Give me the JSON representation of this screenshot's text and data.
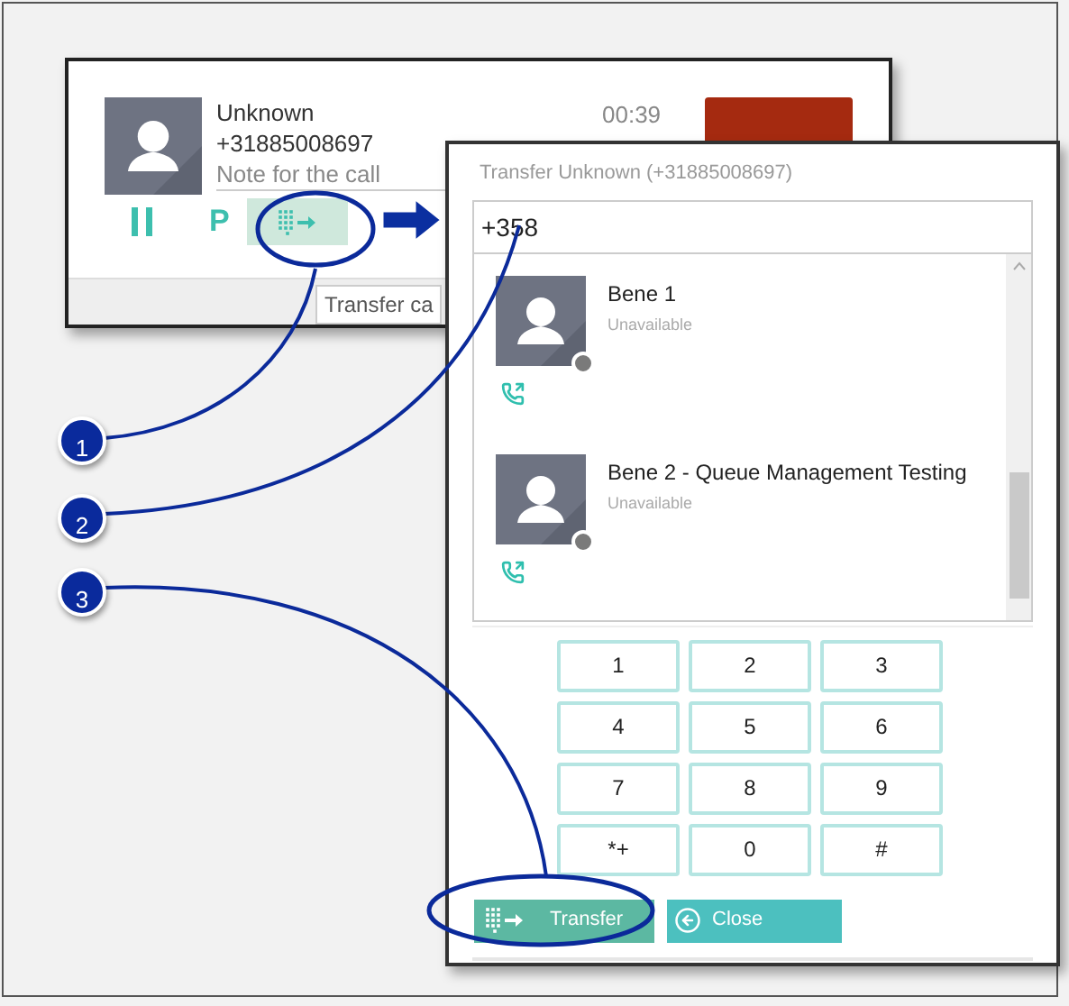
{
  "call_card": {
    "caller_name": "Unknown",
    "caller_number": "+31885008697",
    "note": "Note for the call",
    "timer": "00:39",
    "park_label": "P",
    "tooltip": "Transfer ca"
  },
  "transfer_dialog": {
    "title": "Transfer Unknown (+31885008697)",
    "search": {
      "value": "+358"
    },
    "contacts": [
      {
        "name": "Bene 1",
        "status": "Unavailable"
      },
      {
        "name": "Bene 2 - Queue Management Testing",
        "status": "Unavailable"
      }
    ],
    "keypad": [
      "1",
      "2",
      "3",
      "4",
      "5",
      "6",
      "7",
      "8",
      "9",
      "*+",
      "0",
      "#"
    ],
    "buttons": [
      {
        "kind": "transfer",
        "label": "Transfer"
      },
      {
        "kind": "close",
        "label": "Close"
      }
    ]
  },
  "callouts": [
    "1",
    "2",
    "3"
  ]
}
